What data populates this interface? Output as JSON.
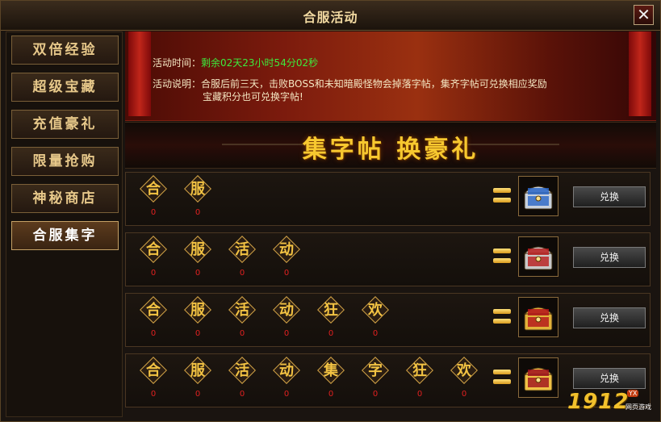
{
  "window": {
    "title": "合服活动",
    "close_label": "✕"
  },
  "sidebar": {
    "items": [
      {
        "label": "双倍经验",
        "active": false
      },
      {
        "label": "超级宝藏",
        "active": false
      },
      {
        "label": "充值豪礼",
        "active": false
      },
      {
        "label": "限量抢购",
        "active": false
      },
      {
        "label": "神秘商店",
        "active": false
      },
      {
        "label": "合服集字",
        "active": true
      }
    ]
  },
  "banner": {
    "time_label": "活动时间：",
    "time_value": "剩余02天23小时54分02秒",
    "desc_label": "活动说明：",
    "desc_line1": "合服后前三天，击败BOSS和未知暗殿怪物会掉落字帖，集齐字帖可兑换相应奖励",
    "desc_line2": "宝藏积分也可兑换字帖!"
  },
  "headline": {
    "text": "集字帖 换豪礼"
  },
  "rows": [
    {
      "tiles": [
        {
          "char": "合",
          "count": "0"
        },
        {
          "char": "服",
          "count": "0"
        }
      ],
      "chest": "silver-blue-chest-icon",
      "button": "兑换"
    },
    {
      "tiles": [
        {
          "char": "合",
          "count": "0"
        },
        {
          "char": "服",
          "count": "0"
        },
        {
          "char": "活",
          "count": "0"
        },
        {
          "char": "动",
          "count": "0"
        }
      ],
      "chest": "silver-red-chest-icon",
      "button": "兑换"
    },
    {
      "tiles": [
        {
          "char": "合",
          "count": "0"
        },
        {
          "char": "服",
          "count": "0"
        },
        {
          "char": "活",
          "count": "0"
        },
        {
          "char": "动",
          "count": "0"
        },
        {
          "char": "狂",
          "count": "0"
        },
        {
          "char": "欢",
          "count": "0"
        }
      ],
      "chest": "gold-red-chest-icon",
      "button": "兑换"
    },
    {
      "tiles": [
        {
          "char": "合",
          "count": "0"
        },
        {
          "char": "服",
          "count": "0"
        },
        {
          "char": "活",
          "count": "0"
        },
        {
          "char": "动",
          "count": "0"
        },
        {
          "char": "集",
          "count": "0"
        },
        {
          "char": "字",
          "count": "0"
        },
        {
          "char": "狂",
          "count": "0"
        },
        {
          "char": "欢",
          "count": "0"
        }
      ],
      "chest": "gold-ruby-chest-icon",
      "button": "兑换"
    }
  ],
  "logo": {
    "number": "1912",
    "badge": "YX",
    "sub": "网页游戏"
  },
  "colors": {
    "tile_text": "#f3c343",
    "count": "#e02020",
    "time_value": "#3dea3d",
    "headline": "#f7c82f"
  }
}
